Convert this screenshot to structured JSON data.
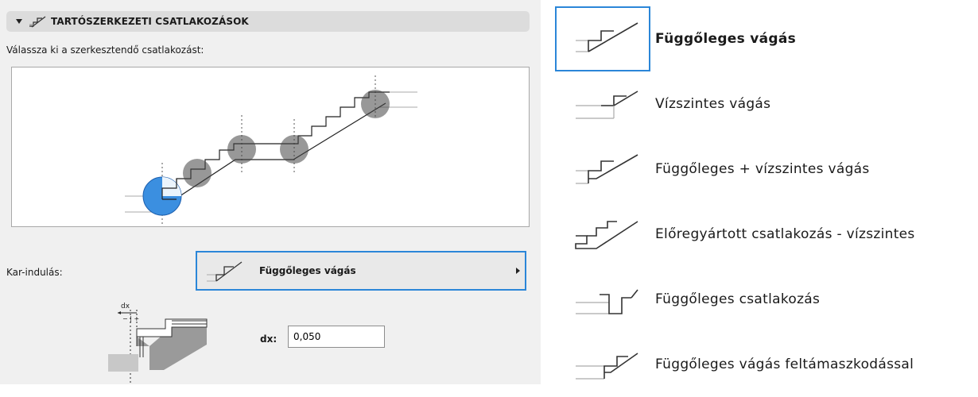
{
  "section": {
    "title": "TARTÓSZERKEZETI CSATLAKOZÁSOK",
    "prompt": "Válassza ki a szerkesztendő csatlakozást:"
  },
  "kar": {
    "label": "Kar-indulás:",
    "selected": "Függőleges vágás"
  },
  "dx": {
    "label": "dx:",
    "value": "0,050",
    "diagram_label": "dx",
    "diagram_sign": "− | +"
  },
  "options": [
    {
      "label": "Függőleges vágás",
      "icon": "vertical-cut-icon",
      "selected": true
    },
    {
      "label": "Vízszintes vágás",
      "icon": "horizontal-cut-icon",
      "selected": false
    },
    {
      "label": "Függőleges + vízszintes vágás",
      "icon": "vertical-horizontal-cut-icon",
      "selected": false
    },
    {
      "label": "Előregyártott csatlakozás - vízszintes",
      "icon": "precast-horizontal-connection-icon",
      "selected": false
    },
    {
      "label": "Függőleges csatlakozás",
      "icon": "vertical-connection-icon",
      "selected": false
    },
    {
      "label": "Függőleges vágás feltámaszkodással",
      "icon": "vertical-cut-with-support-icon",
      "selected": false
    }
  ],
  "colors": {
    "accent": "#2b86d8",
    "panel_bg": "#f0f0f0",
    "header_bg": "#dcdcdc"
  }
}
